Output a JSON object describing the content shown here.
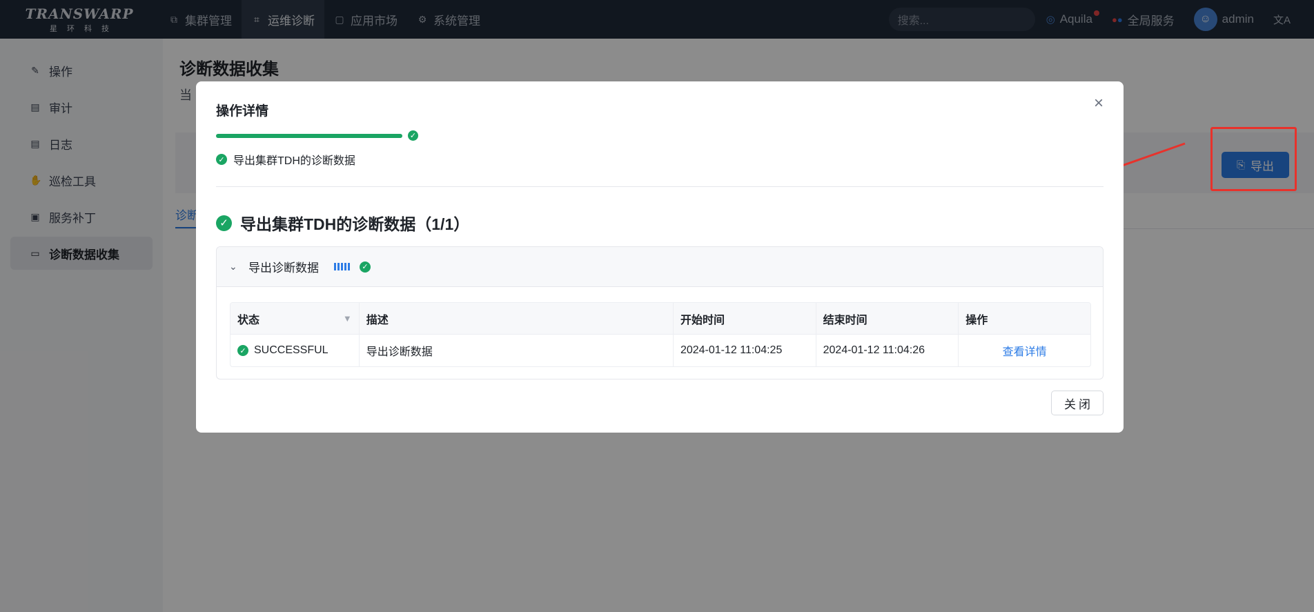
{
  "topbar": {
    "logo_main": "TRANSWARP",
    "logo_sub": "星环科技",
    "nav": [
      {
        "label": "集群管理",
        "icon": "sitemap-icon"
      },
      {
        "label": "运维诊断",
        "icon": "diagnose-icon",
        "active": true
      },
      {
        "label": "应用市场",
        "icon": "store-icon"
      },
      {
        "label": "系统管理",
        "icon": "gear-icon"
      }
    ],
    "search_placeholder": "搜索...",
    "aquila_label": "Aquila",
    "global_service_label": "全局服务",
    "user_name": "admin",
    "language_icon": "translate-icon"
  },
  "sidebar": {
    "items": [
      {
        "label": "操作",
        "icon": "edit-doc-icon"
      },
      {
        "label": "审计",
        "icon": "audit-icon"
      },
      {
        "label": "日志",
        "icon": "log-icon"
      },
      {
        "label": "巡检工具",
        "icon": "hand-icon"
      },
      {
        "label": "服务补丁",
        "icon": "patch-icon"
      },
      {
        "label": "诊断数据收集",
        "icon": "archive-icon",
        "active": true
      }
    ]
  },
  "main": {
    "page_title": "诊断数据收集",
    "page_sub": "当",
    "export_button": "导出",
    "tab_label": "诊断"
  },
  "modal": {
    "title": "操作详情",
    "progress": 1.0,
    "step_label": "导出集群TDH的诊断数据",
    "section_title": "导出集群TDH的诊断数据（1/1）",
    "collapse_title": "导出诊断数据",
    "table": {
      "headers": [
        "状态",
        "描述",
        "开始时间",
        "结束时间",
        "操作"
      ],
      "rows": [
        {
          "status": "SUCCESSFUL",
          "description": "导出诊断数据",
          "start_time": "2024-01-12 11:04:25",
          "end_time": "2024-01-12 11:04:26",
          "action": "查看详情"
        }
      ]
    },
    "close_button": "关闭"
  },
  "colors": {
    "accent": "#2d7ce6",
    "success": "#1aa563",
    "annotation": "#e8322b",
    "topbar": "#1f2a3a"
  }
}
